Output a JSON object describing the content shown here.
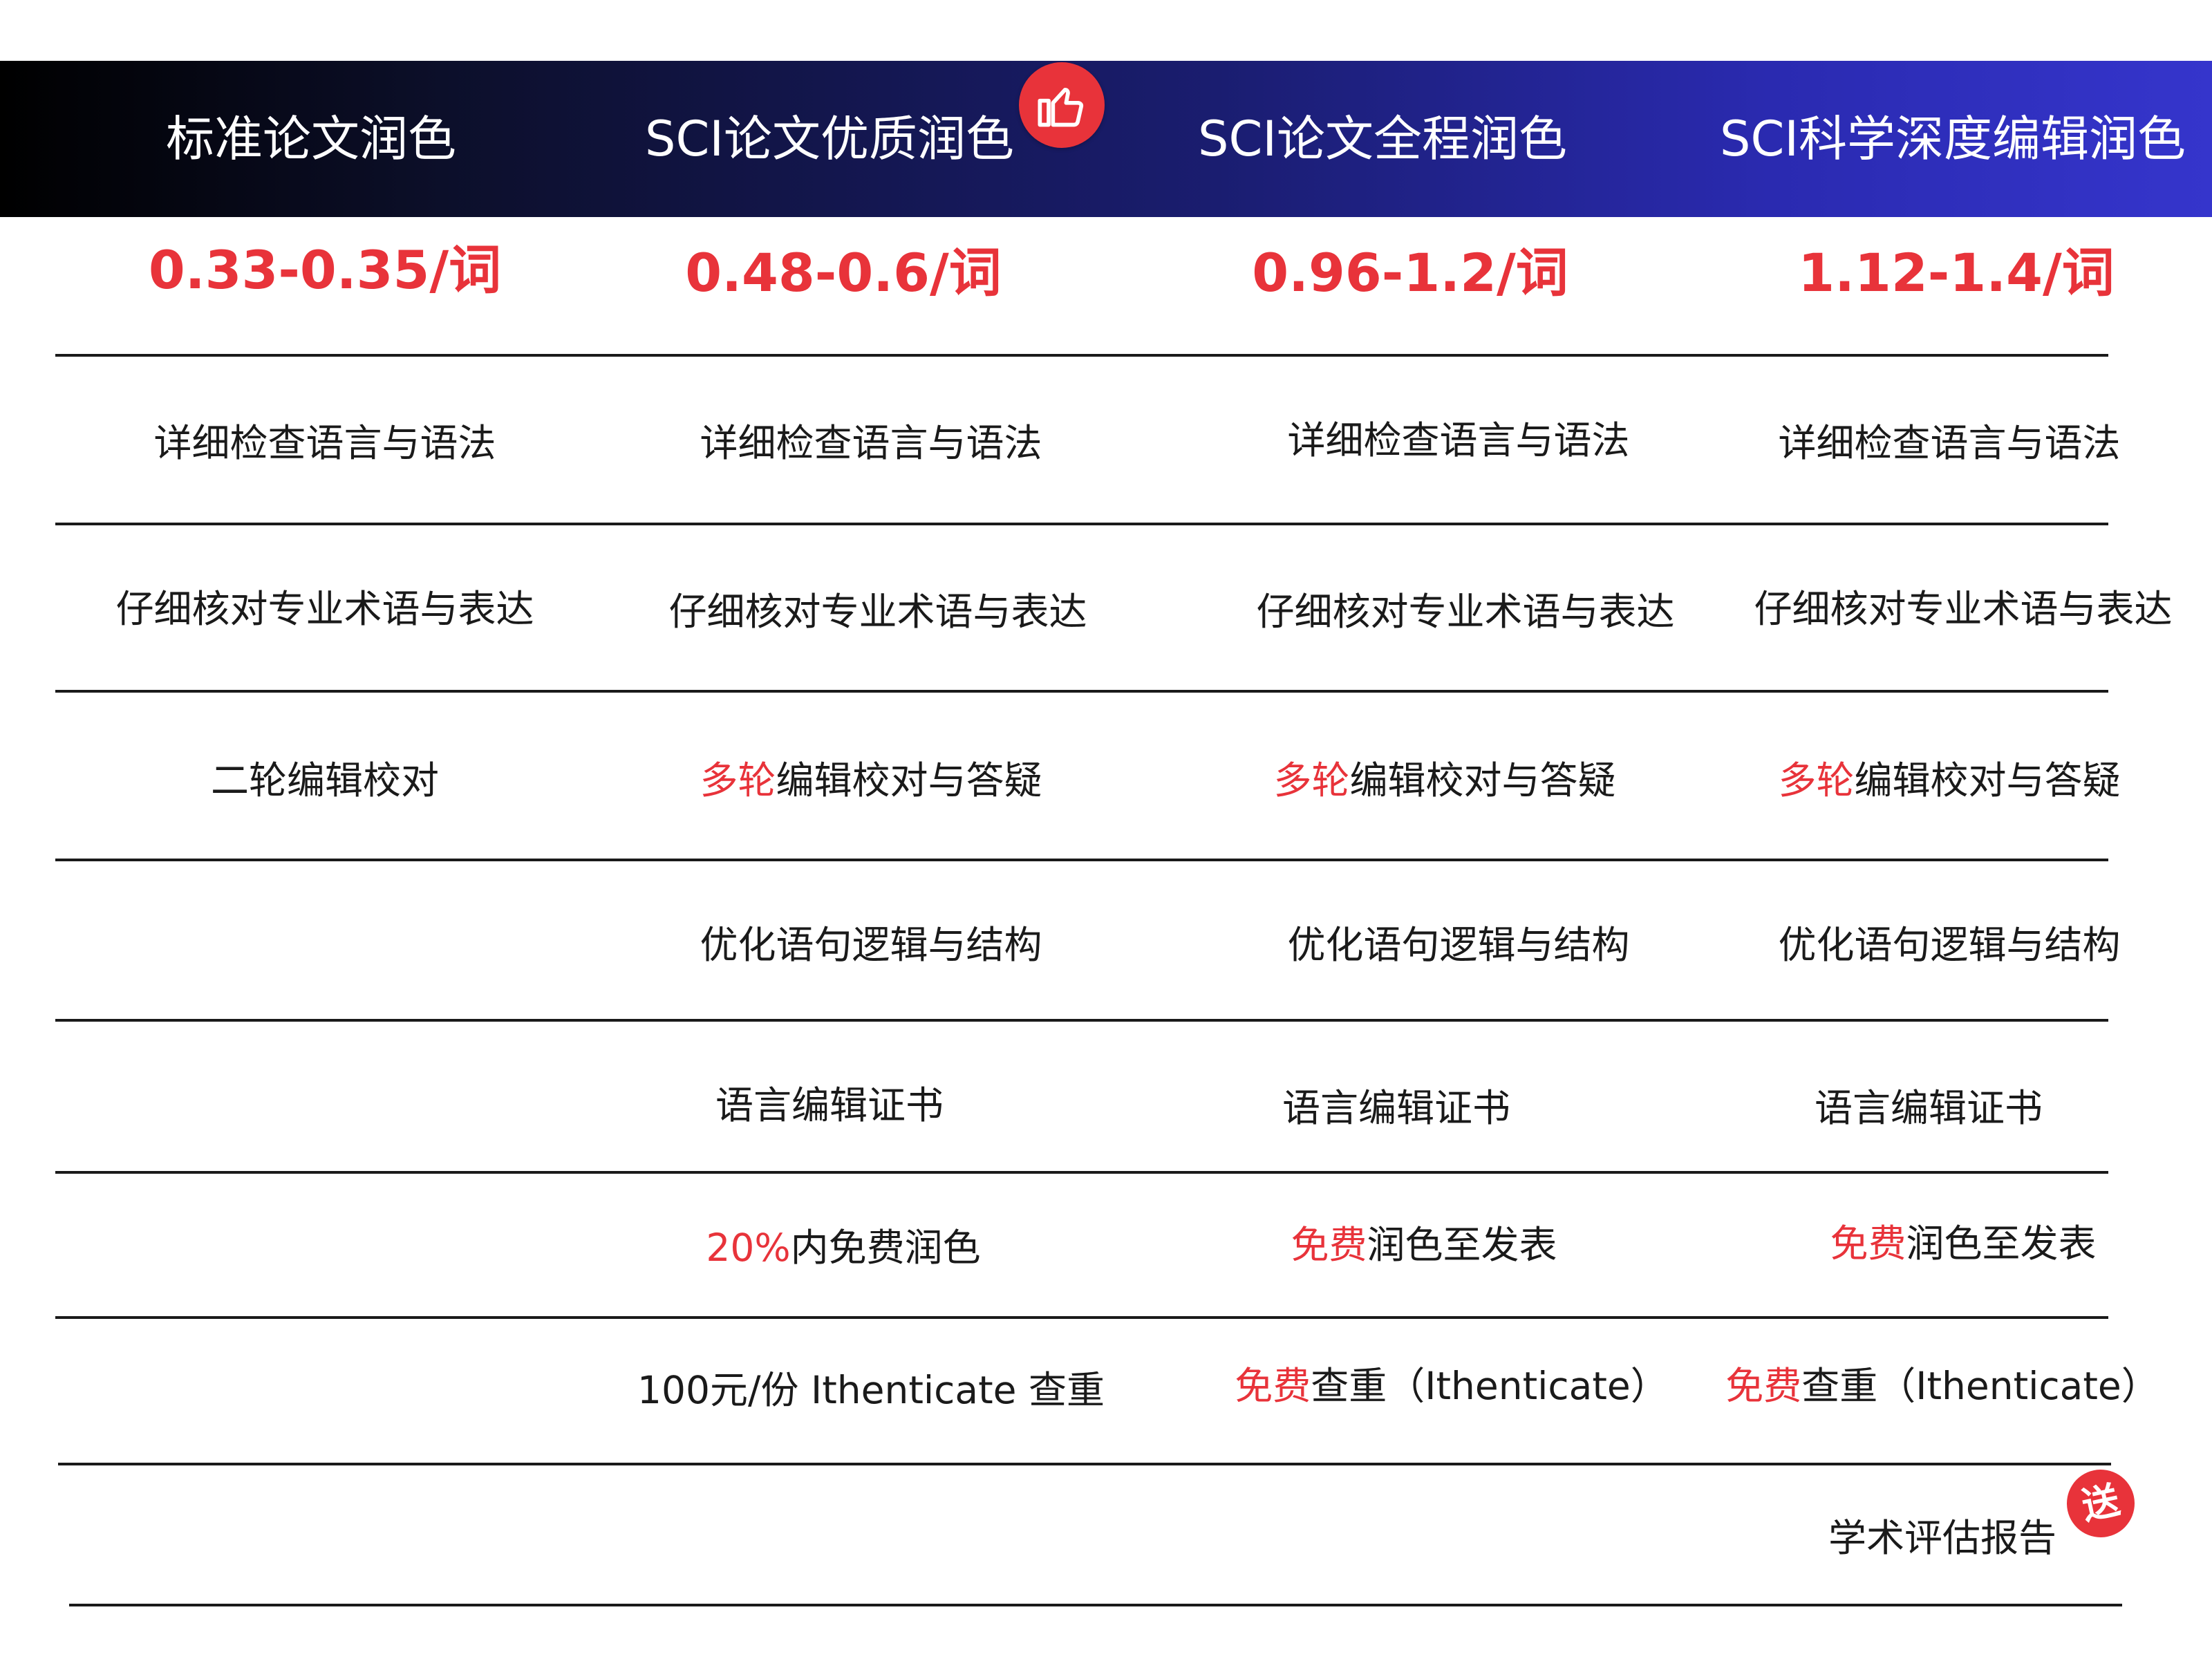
{
  "columns": [
    {
      "title": "标准论文润色",
      "price": "0.33-0.35/词"
    },
    {
      "title": "SCI论文优质润色",
      "price": "0.48-0.6/词"
    },
    {
      "title": "SCI论文全程润色",
      "price": "0.96-1.2/词"
    },
    {
      "title": "SCI科学深度编辑润色",
      "price": "1.12-1.4/词"
    }
  ],
  "rows": {
    "language_check": {
      "c1": "详细检查语言与语法",
      "c2": "详细检查语言与语法",
      "c3": "详细检查语言与语法",
      "c4": "详细检查语言与语法"
    },
    "terminology": {
      "c1": "仔细核对专业术语与表达",
      "c2": "仔细核对专业术语与表达",
      "c3": "仔细核对专业术语与表达",
      "c4": "仔细核对专业术语与表达"
    },
    "proofreading": {
      "c1": "二轮编辑校对",
      "c2_hl": "多轮",
      "c2_rest": "编辑校对与答疑",
      "c3_hl": "多轮",
      "c3_rest": "编辑校对与答疑",
      "c4_hl": "多轮",
      "c4_rest": "编辑校对与答疑"
    },
    "logic": {
      "c2": "优化语句逻辑与结构",
      "c3": "优化语句逻辑与结构",
      "c4": "优化语句逻辑与结构"
    },
    "certificate": {
      "c2": "语言编辑证书",
      "c3": "语言编辑证书",
      "c4": "语言编辑证书"
    },
    "free_polish": {
      "c2_hl": "20%",
      "c2_rest": "内免费润色",
      "c3_hl": "免费",
      "c3_rest": "润色至发表",
      "c4_hl": "免费",
      "c4_rest": "润色至发表"
    },
    "plagiarism": {
      "c2": "100元/份 Ithenticate 查重",
      "c3_hl": "免费",
      "c3_rest": "查重（Ithenticate）",
      "c4_hl": "免费",
      "c4_rest": "查重（Ithenticate）"
    },
    "assessment": {
      "c4": "学术评估报告"
    }
  },
  "badges": {
    "recommend_icon": "thumbs-up-icon",
    "gift_text": "送"
  },
  "colors": {
    "accent_red": "#e8333a",
    "header_start": "#000000",
    "header_end": "#3535cc"
  }
}
